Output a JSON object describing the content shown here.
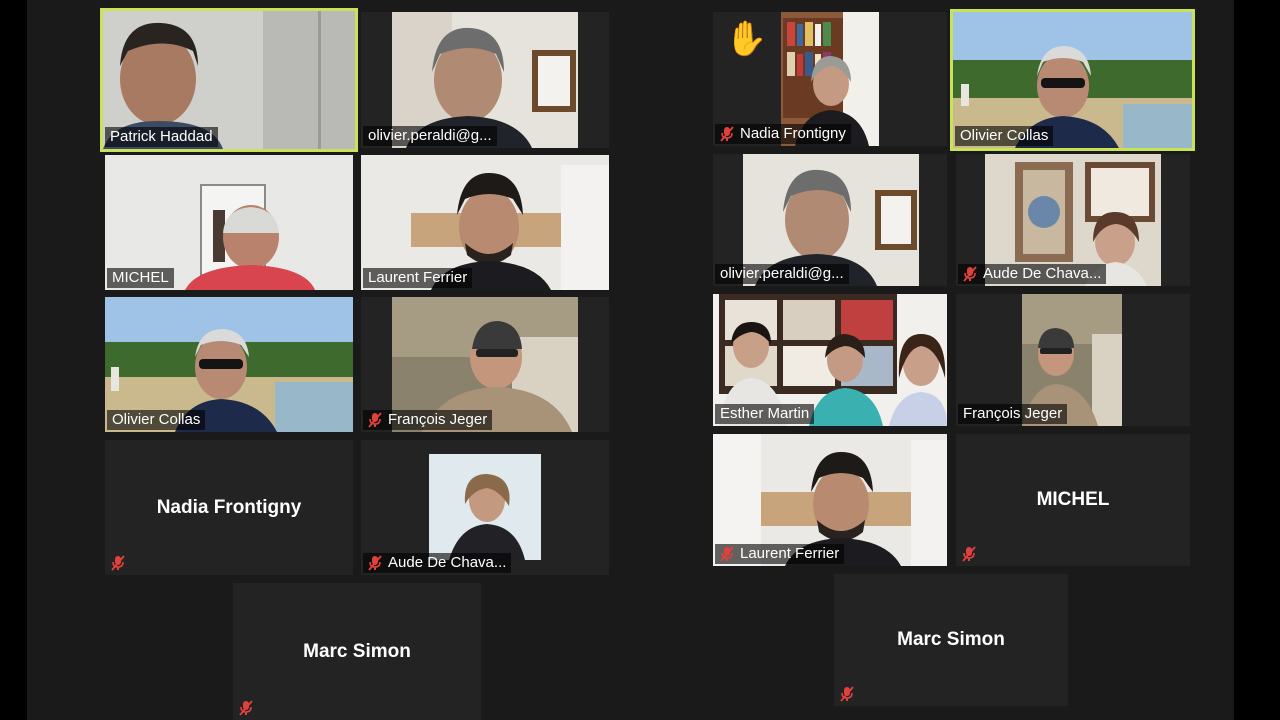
{
  "left_gallery": {
    "patrick": "Patrick Haddad",
    "peraldi": "olivier.peraldi@g...",
    "michel": "MICHEL",
    "ferrier": "Laurent Ferrier",
    "collas": "Olivier Collas",
    "jeger": "François Jeger",
    "nadia": "Nadia Frontigny",
    "aude": "Aude De Chava...",
    "marc": "Marc Simon"
  },
  "right_gallery": {
    "nadia": "Nadia Frontigny",
    "collas": "Olivier Collas",
    "peraldi": "olivier.peraldi@g...",
    "aude": "Aude De Chava...",
    "esther": "Esther Martin",
    "jeger": "François Jeger",
    "ferrier": "Laurent Ferrier",
    "michel": "MICHEL",
    "marc": "Marc Simon"
  },
  "icons": {
    "mute": "microphone-muted-icon",
    "hand": "raised-hand-icon"
  },
  "colors": {
    "active_speaker_border": "#c8e35a",
    "mute_icon": "#e0413c",
    "tile_bg": "#232323"
  }
}
